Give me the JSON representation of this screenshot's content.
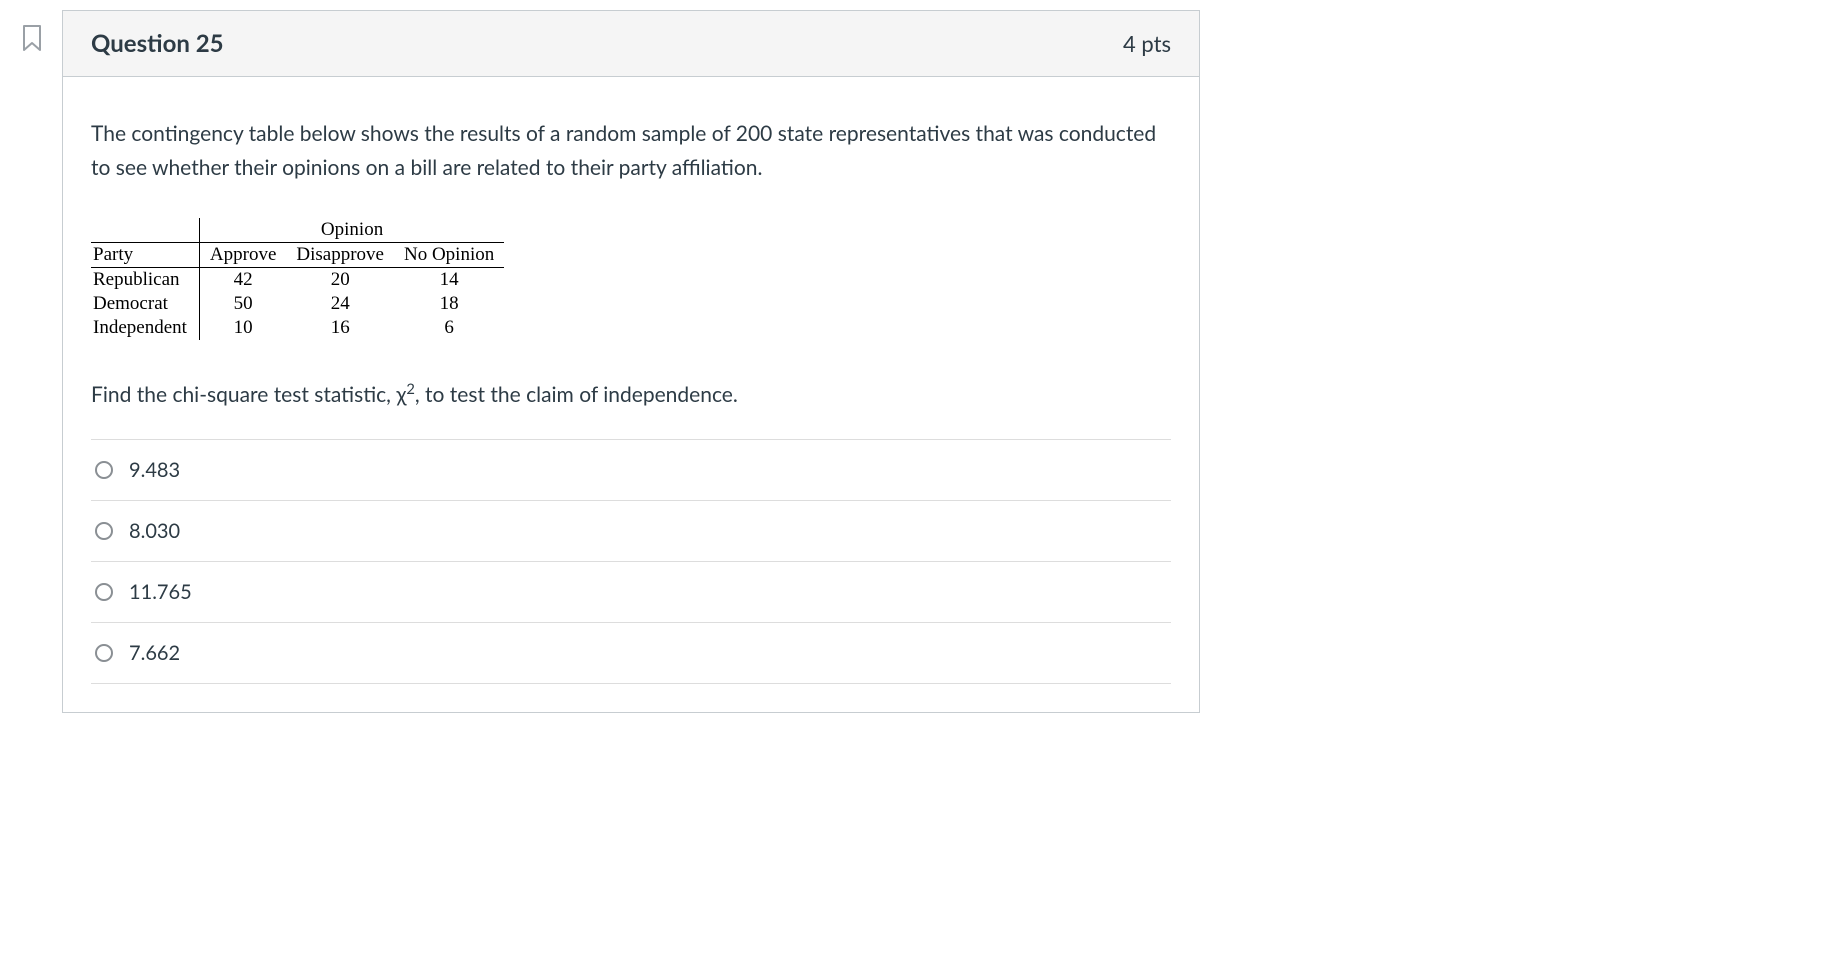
{
  "header": {
    "title": "Question 25",
    "points": "4 pts"
  },
  "prompt": "The contingency table below shows the results of a random sample of 200 state representatives that was conducted to see whether their opinions on a bill are related to their party affiliation.",
  "chart_data": {
    "type": "table",
    "row_header": "Party",
    "col_group_header": "Opinion",
    "columns": [
      "Approve",
      "Disapprove",
      "No Opinion"
    ],
    "rows": [
      {
        "label": "Republican",
        "values": [
          42,
          20,
          14
        ]
      },
      {
        "label": "Democrat",
        "values": [
          50,
          24,
          18
        ]
      },
      {
        "label": "Independent",
        "values": [
          10,
          16,
          6
        ]
      }
    ]
  },
  "question2_pre": "Find the chi-square test statistic, χ",
  "question2_sup": "2",
  "question2_post": ", to test the claim of independence.",
  "answers": [
    {
      "label": "9.483"
    },
    {
      "label": "8.030"
    },
    {
      "label": "11.765"
    },
    {
      "label": "7.662"
    }
  ]
}
